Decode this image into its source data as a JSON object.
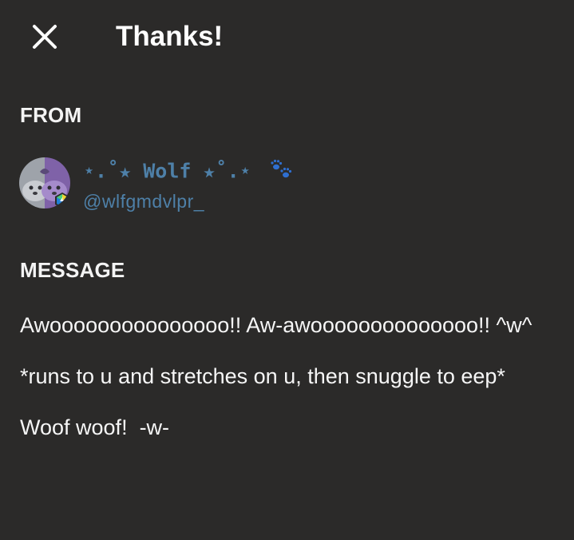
{
  "header": {
    "title": "Thanks!",
    "close_icon": "close-icon"
  },
  "from": {
    "label": "FROM",
    "sender": {
      "display_name": "⋆.˚★ Wolf ★˚.⋆",
      "paw_icon": "paw-prints-icon",
      "handle": "@wlfgmdvlpr_",
      "avatar_icon": "seal-avatar",
      "badge_icon": "verified-badge-icon"
    }
  },
  "message": {
    "label": "MESSAGE",
    "paragraphs": [
      "Awooooooooooooooo!! Aw-awoooooooooooooo!! ^w^",
      "*runs to u and stretches on u, then snuggle to eep*",
      "Woof woof!  -w-"
    ]
  },
  "colors": {
    "background": "#2b2a29",
    "accent_blue": "#4e80a8",
    "text": "#f6f6f6"
  }
}
